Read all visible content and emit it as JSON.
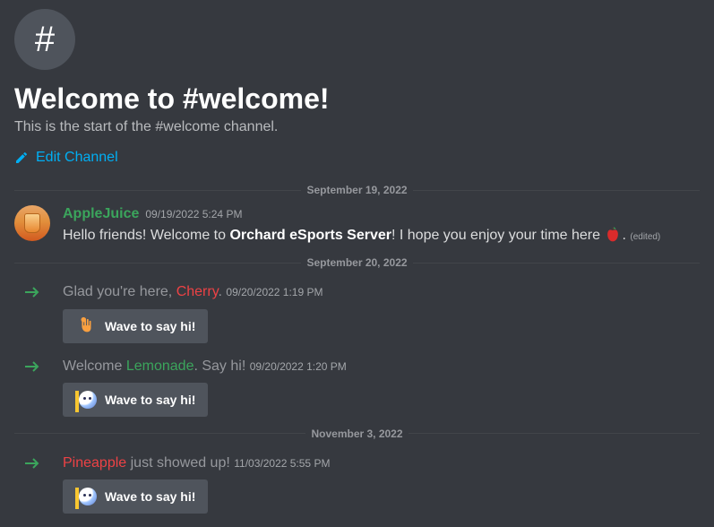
{
  "header": {
    "title": "Welcome to #welcome!",
    "subtitle": "This is the start of the #welcome channel.",
    "edit_label": "Edit Channel"
  },
  "dividers": {
    "d1": "September 19, 2022",
    "d2": "September 20, 2022",
    "d3": "November 3, 2022"
  },
  "messages": {
    "m1": {
      "author": "AppleJuice",
      "author_color": "#3ba55c",
      "timestamp": "09/19/2022 5:24 PM",
      "text_pre": "Hello friends! Welcome to ",
      "text_bold": "Orchard eSports Server",
      "text_post": "! I hope you enjoy your time here ",
      "text_end": ".",
      "edited": "(edited)"
    }
  },
  "system": {
    "s1": {
      "pre": "Glad you're here, ",
      "name": "Cherry",
      "name_color": "#ed4245",
      "post": ". ",
      "timestamp": "09/20/2022 1:19 PM",
      "button": "Wave to say hi!"
    },
    "s2": {
      "pre": "Welcome ",
      "name": "Lemonade",
      "name_color": "#3ba55c",
      "post": ". Say hi! ",
      "timestamp": "09/20/2022 1:20 PM",
      "button": "Wave to say hi!"
    },
    "s3": {
      "pre": "",
      "name": "Pineapple",
      "name_color": "#ed4245",
      "post": " just showed up! ",
      "timestamp": "11/03/2022 5:55 PM",
      "button": "Wave to say hi!"
    }
  }
}
